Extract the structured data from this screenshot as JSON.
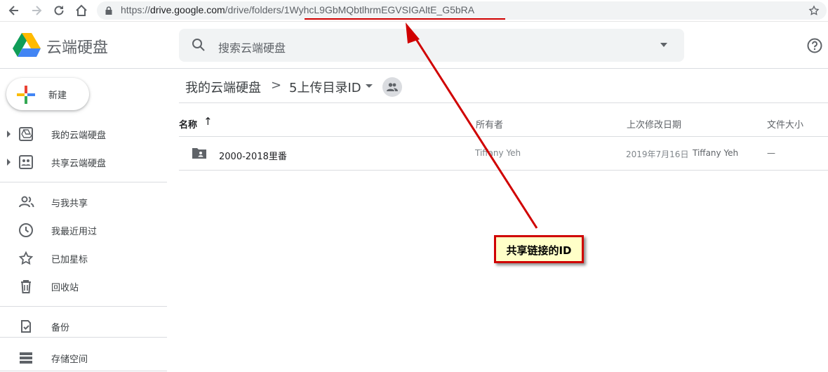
{
  "browser": {
    "url_prefix": "https://",
    "url_host": "drive.google.com",
    "url_path": "/drive/folders/",
    "url_id": "1WyhcL9GbMQbtlhrmEGVSIGAltE_G5bRA"
  },
  "header": {
    "app_title": "云端硬盘",
    "search_placeholder": "搜索云端硬盘"
  },
  "sidebar": {
    "new_label": "新建",
    "items": [
      {
        "label": "我的云端硬盘",
        "icon": "my-drive-icon"
      },
      {
        "label": "共享云端硬盘",
        "icon": "shared-drives-icon"
      },
      {
        "label": "与我共享",
        "icon": "people-icon"
      },
      {
        "label": "我最近用过",
        "icon": "clock-icon"
      },
      {
        "label": "已加星标",
        "icon": "star-icon"
      },
      {
        "label": "回收站",
        "icon": "trash-icon"
      },
      {
        "label": "备份",
        "icon": "backup-icon"
      },
      {
        "label": "存储空间",
        "icon": "storage-icon"
      }
    ]
  },
  "breadcrumb": {
    "root": "我的云端硬盘",
    "separator": ">",
    "current": "5上传目录ID"
  },
  "table": {
    "columns": [
      "名称",
      "所有者",
      "上次修改日期",
      "文件大小"
    ],
    "sort_arrow": "↑",
    "rows": [
      {
        "name": "2000-2018里番",
        "owner": "Tiffany Yeh",
        "modified_date": "2019年7月16日",
        "modified_by": "Tiffany Yeh",
        "size": "—"
      }
    ]
  },
  "annotation": {
    "label": "共享链接的ID",
    "color": "#d00000"
  }
}
